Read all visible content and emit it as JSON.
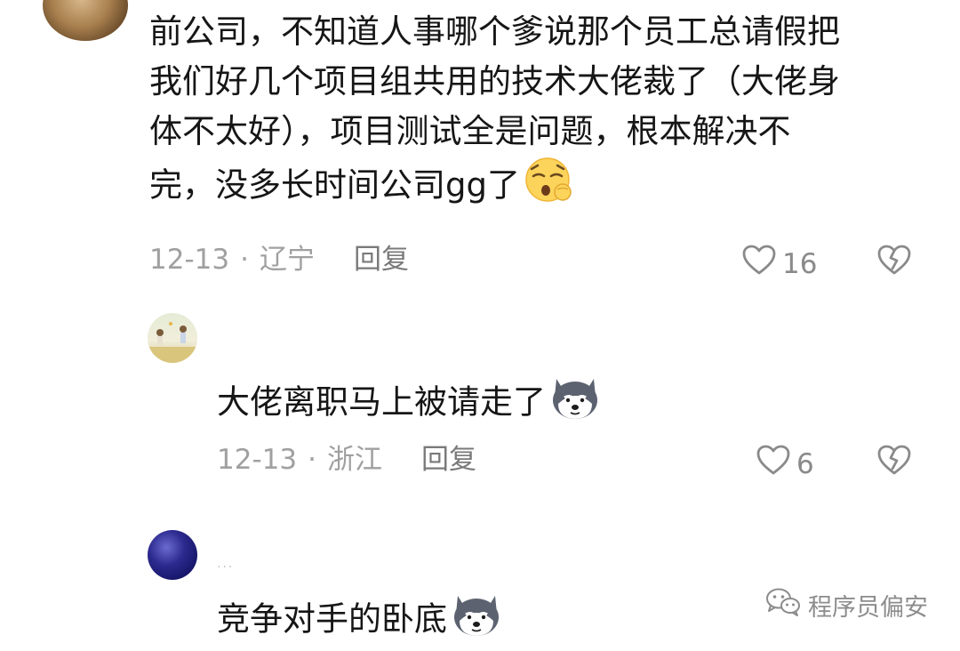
{
  "comment": {
    "lines": [
      "前公司，不知道人事哪个爹说那个员工总请假把",
      "我们好几个项目组共用的技术大佬裁了（大佬身",
      "体不太好），项目测试全是问题，根本解决不",
      "完，没多长时间公司gg了"
    ],
    "date": "12-13",
    "location": "辽宁",
    "reply_label": "回复",
    "likes": "16",
    "emoji": "yawning-face-emoji"
  },
  "replies": [
    {
      "text": "大佬离职马上被请走了",
      "date": "12-13",
      "location": "浙江",
      "reply_label": "回复",
      "likes": "6",
      "emoji": "husky-dog-emoji"
    },
    {
      "username": "...",
      "text": "竞争对手的卧底",
      "emoji": "husky-dog-emoji"
    }
  ],
  "separator": "·",
  "watermark": "程序员偏安",
  "icons": {
    "like": "heart-outline-icon",
    "dislike": "broken-heart-icon",
    "watermark": "wechat-icon"
  },
  "colors": {
    "text": "#161616",
    "meta": "#a0a0a0",
    "icon": "#8a8a8a"
  }
}
